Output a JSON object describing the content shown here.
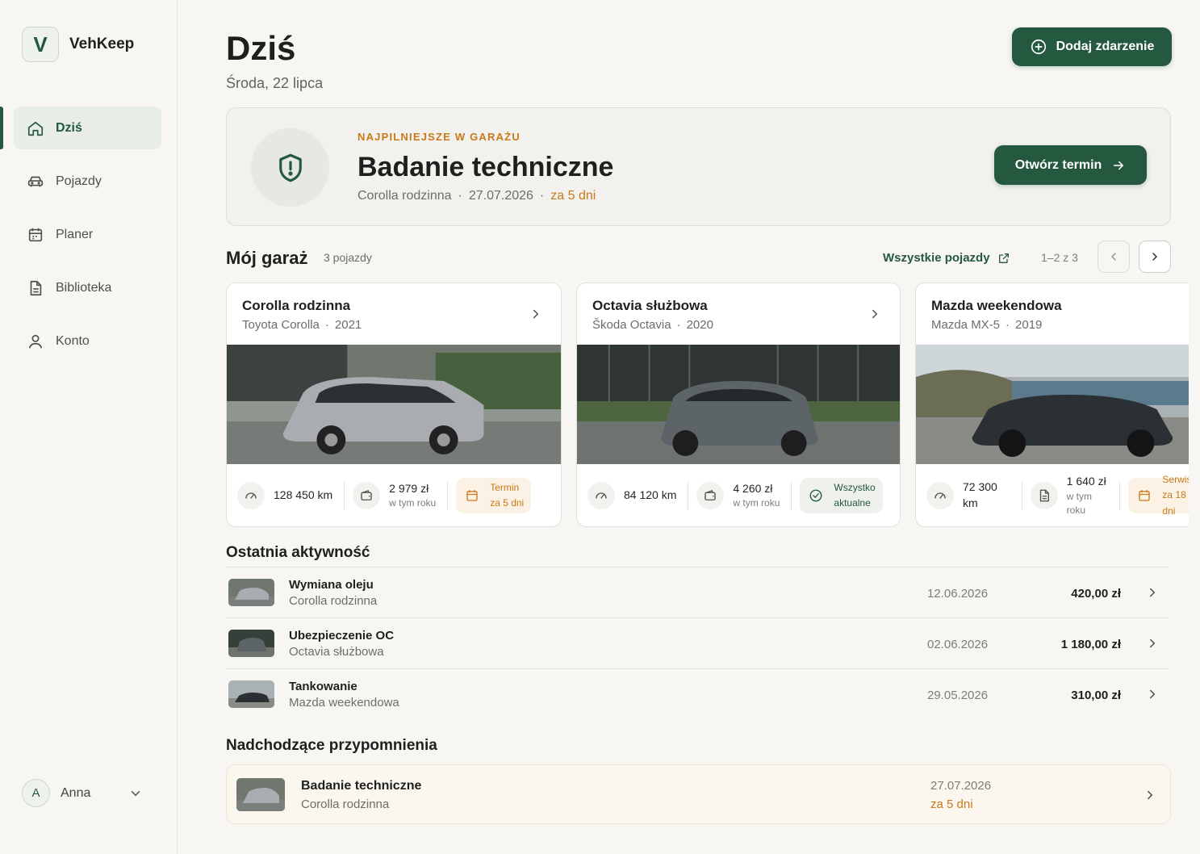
{
  "app": {
    "logo_letter": "V",
    "name": "VehKeep"
  },
  "nav": [
    {
      "label": "Dziś",
      "icon": "home-icon",
      "active": true
    },
    {
      "label": "Pojazdy",
      "icon": "car-icon",
      "active": false
    },
    {
      "label": "Planer",
      "icon": "calendar-icon",
      "active": false
    },
    {
      "label": "Biblioteka",
      "icon": "document-icon",
      "active": false
    },
    {
      "label": "Konto",
      "icon": "user-icon",
      "active": false
    }
  ],
  "user": {
    "initial": "A",
    "name": "Anna"
  },
  "header": {
    "title": "Dziś",
    "date": "Środa, 22 lipca",
    "add_button": "Dodaj zdarzenie"
  },
  "hero": {
    "kicker": "NAJPILNIEJSZE W GARAŻU",
    "title": "Badanie techniczne",
    "vehicle": "Corolla rodzinna",
    "date": "27.07.2026",
    "due": "za 5 dni",
    "button": "Otwórz termin"
  },
  "garage": {
    "title": "Mój garaż",
    "count": "3 pojazdy",
    "all_link": "Wszystkie pojazdy",
    "pager": "1–2 z 3",
    "cars": [
      {
        "name": "Corolla rodzinna",
        "model": "Toyota Corolla",
        "year": "2021",
        "km": "128 450 km",
        "cost": "2 979 zł",
        "cost_label": "w tym roku",
        "status_line1": "Termin",
        "status_line2": "za 5 dni",
        "status": "warn",
        "color": "#a9adb1"
      },
      {
        "name": "Octavia służbowa",
        "model": "Škoda Octavia",
        "year": "2020",
        "km": "84 120 km",
        "cost": "4 260 zł",
        "cost_label": "w tym roku",
        "status_line1": "Wszystko",
        "status_line2": "aktualne",
        "status": "ok",
        "color": "#5d6468"
      },
      {
        "name": "Mazda weekendowa",
        "model": "Mazda MX-5",
        "year": "2019",
        "km": "72 300 km",
        "cost": "1 640 zł",
        "cost_label": "w tym roku",
        "status_line1": "Serwis",
        "status_line2": "za 18 dni",
        "status": "warn",
        "color": "#2a3034"
      }
    ]
  },
  "activity": {
    "title": "Ostatnia aktywność",
    "items": [
      {
        "title": "Wymiana oleju",
        "vehicle": "Corolla rodzinna",
        "date": "12.06.2026",
        "amount": "420,00 zł"
      },
      {
        "title": "Ubezpieczenie OC",
        "vehicle": "Octavia służbowa",
        "date": "02.06.2026",
        "amount": "1 180,00 zł"
      },
      {
        "title": "Tankowanie",
        "vehicle": "Mazda weekendowa",
        "date": "29.05.2026",
        "amount": "310,00 zł"
      }
    ]
  },
  "reminders": {
    "title": "Nadchodzące przypomnienia",
    "items": [
      {
        "title": "Badanie techniczne",
        "vehicle": "Corolla rodzinna",
        "date": "27.07.2026",
        "due": "za 5 dni"
      }
    ]
  },
  "colors": {
    "accent": "#24583f",
    "warning": "#c9791a",
    "background": "#f7f6f3"
  }
}
